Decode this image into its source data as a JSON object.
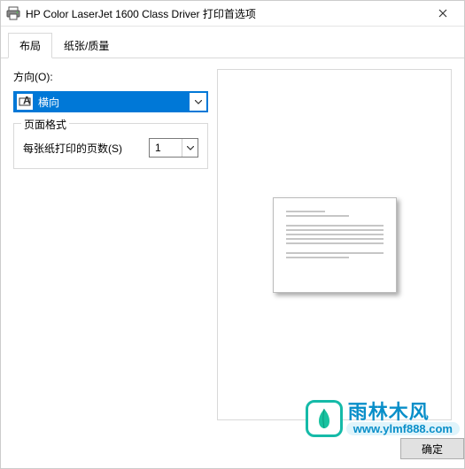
{
  "window": {
    "title": "HP Color LaserJet 1600 Class Driver 打印首选项"
  },
  "tabs": {
    "layout": "布局",
    "paper_quality": "纸张/质量"
  },
  "orientation": {
    "label": "方向(O):",
    "value": "横向"
  },
  "page_format": {
    "legend": "页面格式",
    "pages_per_sheet_label": "每张纸打印的页数(S)",
    "pages_per_sheet_value": "1"
  },
  "buttons": {
    "ok": "确定"
  },
  "watermark": {
    "brand": "雨林木风",
    "url": "www.ylmf888.com"
  }
}
